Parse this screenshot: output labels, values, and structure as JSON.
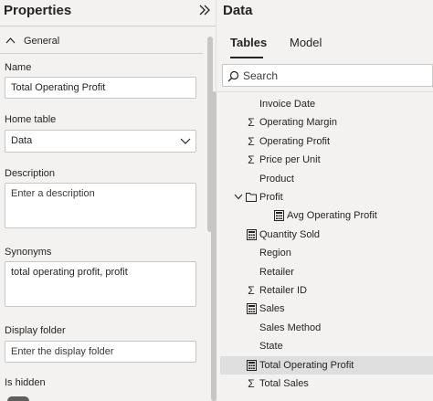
{
  "properties": {
    "title": "Properties",
    "section": "General",
    "name_label": "Name",
    "name_value": "Total Operating Profit",
    "home_table_label": "Home table",
    "home_table_value": "Data",
    "description_label": "Description",
    "description_placeholder": "Enter a description",
    "synonyms_label": "Synonyms",
    "synonyms_value": "total operating profit, profit",
    "display_folder_label": "Display folder",
    "display_folder_placeholder": "Enter the display folder",
    "is_hidden_label": "Is hidden"
  },
  "data_pane": {
    "title": "Data",
    "tabs": [
      {
        "label": "Tables",
        "active": true
      },
      {
        "label": "Model",
        "active": false
      }
    ],
    "search_placeholder": "Search",
    "fields": [
      {
        "icon": "none",
        "label": "Invoice Date"
      },
      {
        "icon": "sigma-icon",
        "label": "Operating Margin"
      },
      {
        "icon": "sigma-icon",
        "label": "Operating Profit"
      },
      {
        "icon": "sigma-icon",
        "label": "Price per Unit"
      },
      {
        "icon": "none",
        "label": "Product"
      },
      {
        "icon": "folder-icon",
        "label": "Profit",
        "expanded": true
      },
      {
        "icon": "calculator-icon",
        "label": "Avg Operating Profit",
        "indent": true
      },
      {
        "icon": "calculator-icon",
        "label": "Quantity Sold"
      },
      {
        "icon": "none",
        "label": "Region"
      },
      {
        "icon": "none",
        "label": "Retailer"
      },
      {
        "icon": "sigma-icon",
        "label": "Retailer ID"
      },
      {
        "icon": "calculator-icon",
        "label": "Sales"
      },
      {
        "icon": "none",
        "label": "Sales Method"
      },
      {
        "icon": "none",
        "label": "State"
      },
      {
        "icon": "calculator-icon",
        "label": "Total Operating Profit",
        "selected": true
      },
      {
        "icon": "sigma-icon",
        "label": "Total Sales"
      }
    ]
  }
}
